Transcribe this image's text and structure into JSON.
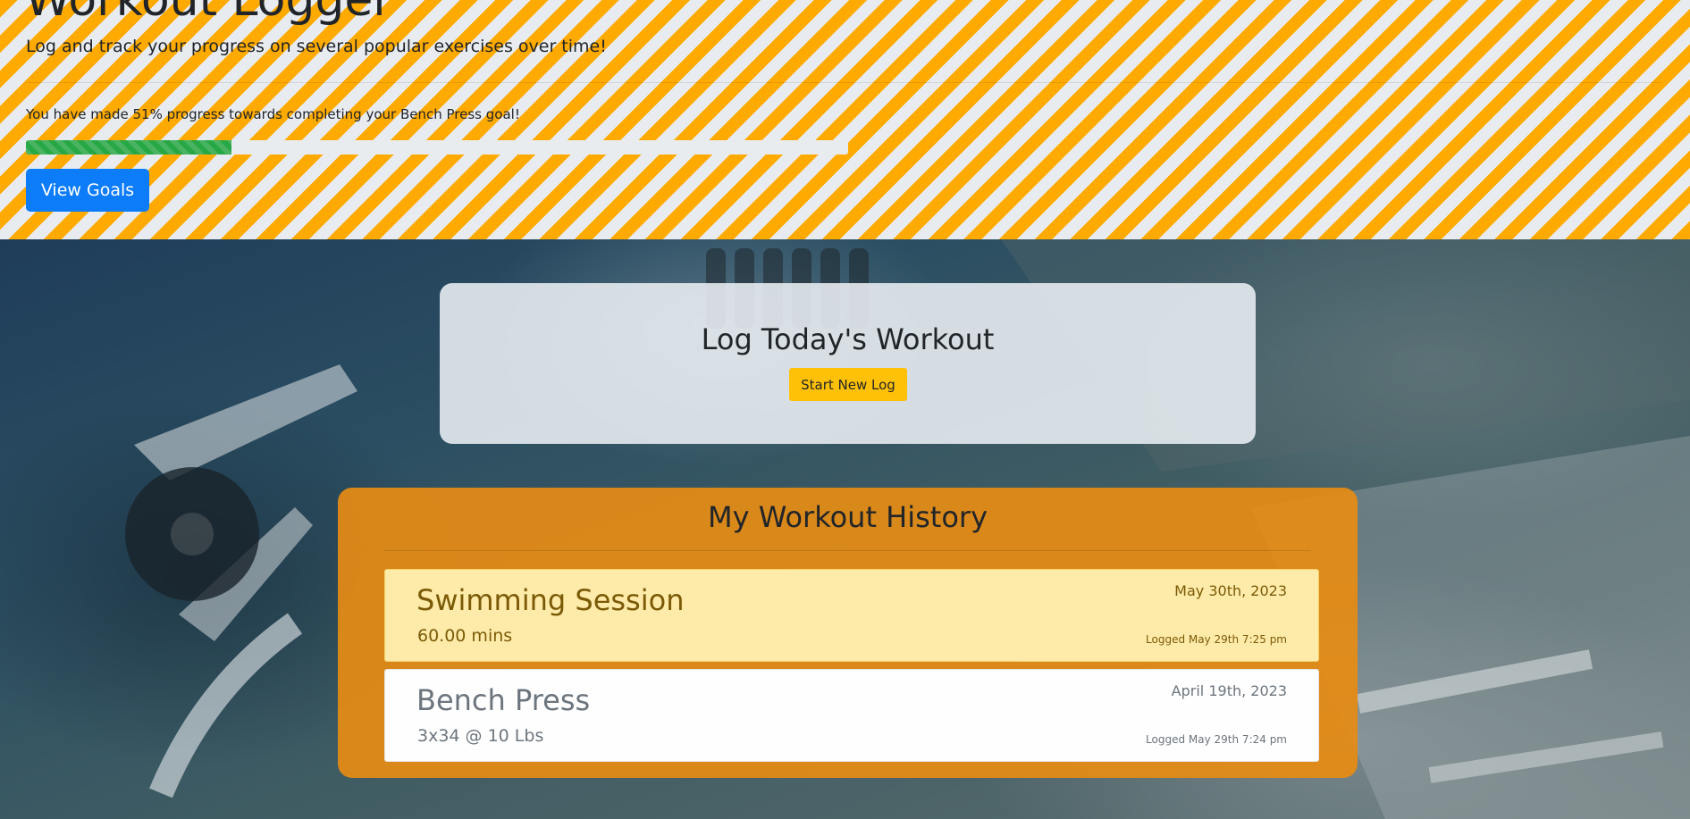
{
  "header": {
    "title": "Workout Logger",
    "subtitle": "Log and track your progress on several popular exercises over time!",
    "progress_text": "You have made 51% progress towards completing your Bench Press goal!",
    "progress_percent": 25,
    "view_goals_label": "View Goals"
  },
  "log_panel": {
    "title": "Log Today's Workout",
    "button_label": "Start New Log"
  },
  "history": {
    "title": "My Workout History",
    "entries": [
      {
        "name": "Swimming Session",
        "detail": "60.00 mins",
        "date": "May 30th, 2023",
        "logged": "Logged May 29th 7:25 pm"
      },
      {
        "name": "Bench Press",
        "detail": "3x34 @ 10 Lbs",
        "date": "April 19th, 2023",
        "logged": "Logged May 29th 7:24 pm"
      }
    ]
  },
  "colors": {
    "stripe_orange": "#ffaa00",
    "stripe_light": "#e8ecf0",
    "primary_button": "#0d7cf8",
    "warning_button": "#ffc107",
    "progress_fill": "#28a745",
    "history_panel": "#e78c14",
    "highlight_entry": "#ffeba9"
  }
}
